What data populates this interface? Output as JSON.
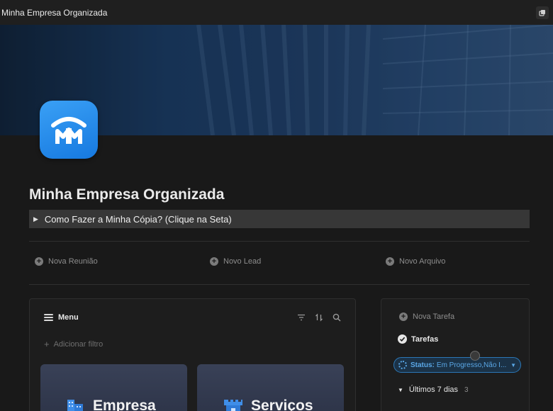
{
  "window": {
    "title": "Minha Empresa Organizada"
  },
  "page": {
    "title": "Minha Empresa Organizada",
    "toggle_text": "Como Fazer a Minha Cópia? (Clique na Seta)"
  },
  "quick_actions": [
    {
      "label": "Nova Reunião"
    },
    {
      "label": "Novo Lead"
    },
    {
      "label": "Novo Arquivo"
    }
  ],
  "menu": {
    "title": "Menu",
    "add_filter": "Adicionar filtro",
    "cards": [
      {
        "label": "Empresa",
        "icon": "building-icon"
      },
      {
        "label": "Serviços",
        "icon": "castle-icon"
      }
    ]
  },
  "tasks": {
    "new_task": "Nova Tarefa",
    "view_name": "Tarefas",
    "filter": {
      "label": "Status:",
      "value": "Em Progresso,Não I..."
    },
    "group": {
      "name": "Últimos 7 dias",
      "count": "3"
    }
  },
  "colors": {
    "accent": "#1679e0",
    "filter_blue": "#5aa7e6",
    "background": "#191919"
  }
}
